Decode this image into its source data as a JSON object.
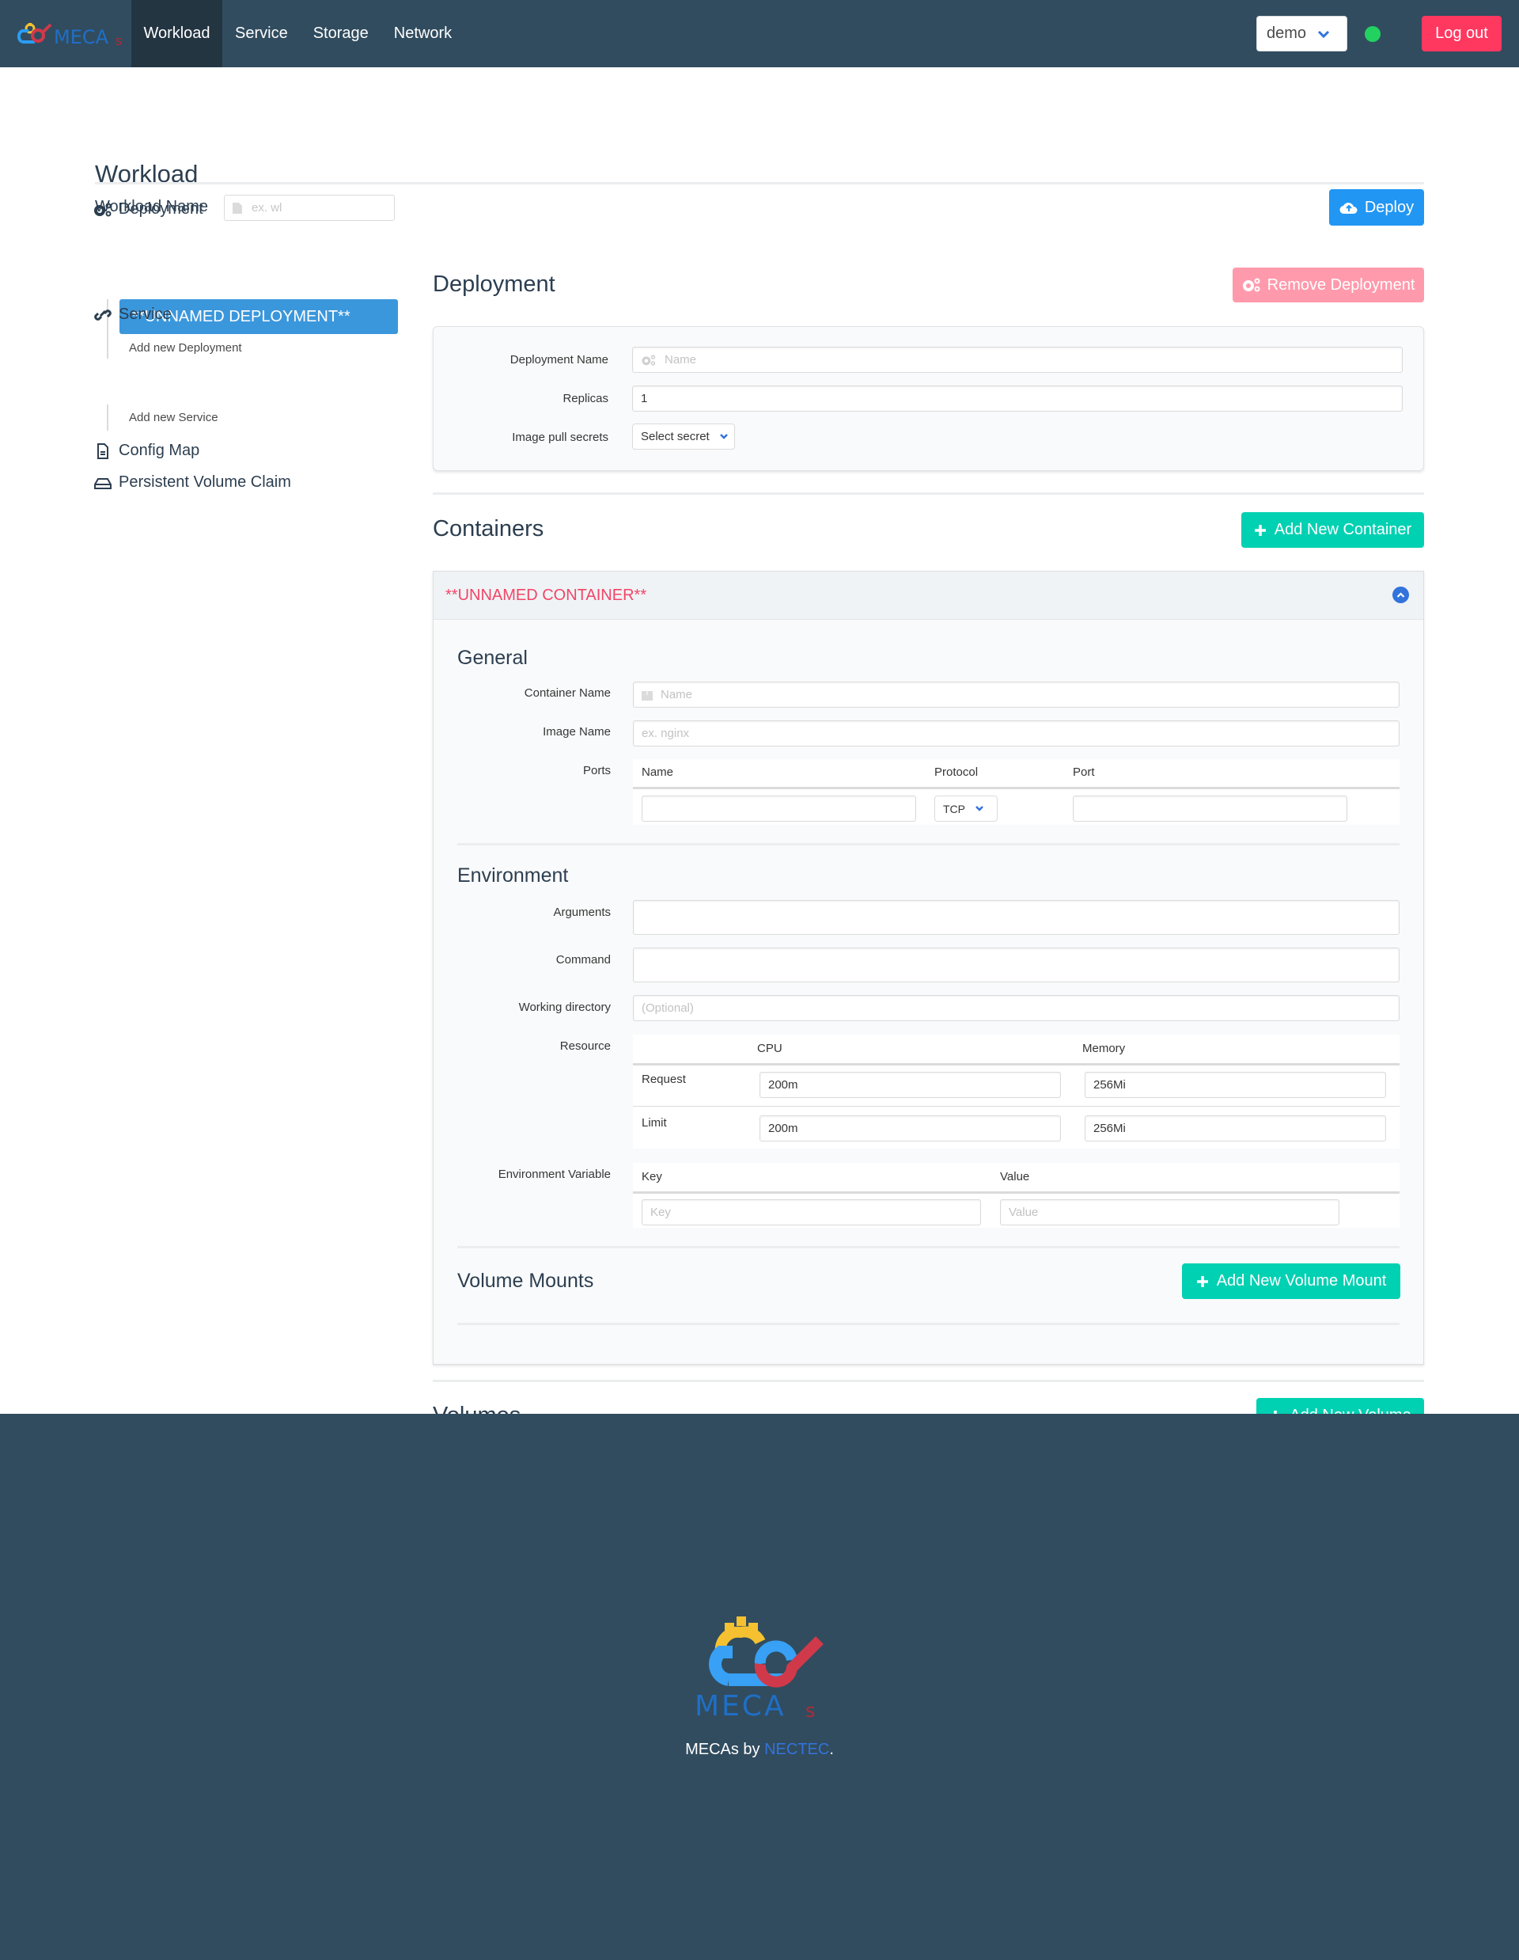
{
  "navbar": {
    "brand": "MECAs",
    "items": [
      {
        "label": "Workload",
        "active": true
      },
      {
        "label": "Service",
        "active": false
      },
      {
        "label": "Storage",
        "active": false
      },
      {
        "label": "Network",
        "active": false
      }
    ],
    "namespace_selected": "demo",
    "status": "online",
    "status_color": "#23d160",
    "logout_label": "Log out"
  },
  "workload": {
    "title": "Workload",
    "name_label": "Workload Name",
    "name_placeholder": "ex. wl",
    "deploy_label": "Deploy"
  },
  "sidebar": {
    "deployment": {
      "label": "Deployment",
      "items": [
        "**UNNAMED DEPLOYMENT**"
      ],
      "add_label": "Add new Deployment"
    },
    "service": {
      "label": "Service",
      "add_label": "Add new Service"
    },
    "config_map": {
      "label": "Config Map"
    },
    "pvc": {
      "label": "Persistent Volume Claim"
    }
  },
  "deployment": {
    "title": "Deployment",
    "remove_label": "Remove Deployment",
    "fields": {
      "name_label": "Deployment Name",
      "name_placeholder": "Name",
      "replicas_label": "Replicas",
      "replicas_value": "1",
      "secrets_label": "Image pull secrets",
      "secrets_selected": "Select secret"
    }
  },
  "containers": {
    "title": "Containers",
    "add_label": "Add New Container",
    "container": {
      "header": "**UNNAMED CONTAINER**",
      "general": {
        "title": "General",
        "container_name_label": "Container Name",
        "container_name_placeholder": "Name",
        "image_name_label": "Image Name",
        "image_name_placeholder": "ex. nginx",
        "ports_label": "Ports",
        "ports_columns": [
          "Name",
          "Protocol",
          "Port"
        ],
        "ports_rows": [
          {
            "name": "",
            "protocol": "TCP",
            "port": ""
          }
        ]
      },
      "environment": {
        "title": "Environment",
        "arguments_label": "Arguments",
        "arguments_value": "",
        "command_label": "Command",
        "command_value": "",
        "workdir_label": "Working directory",
        "workdir_placeholder": "(Optional)",
        "resource_label": "Resource",
        "resource_columns": [
          "CPU",
          "Memory"
        ],
        "resource_rows": [
          {
            "label": "Request",
            "cpu": "200m",
            "memory": "256Mi"
          },
          {
            "label": "Limit",
            "cpu": "200m",
            "memory": "256Mi"
          }
        ],
        "env_label": "Environment Variable",
        "env_columns": [
          "Key",
          "Value"
        ],
        "env_key_placeholder": "Key",
        "env_value_placeholder": "Value"
      },
      "volume_mounts": {
        "title": "Volume Mounts",
        "add_label": "Add New Volume Mount"
      }
    }
  },
  "volumes": {
    "title": "Volumes",
    "add_label": "Add New Volume"
  },
  "footer": {
    "text_prefix": "MECAs by ",
    "link": "NECTEC",
    "text_suffix": "."
  }
}
